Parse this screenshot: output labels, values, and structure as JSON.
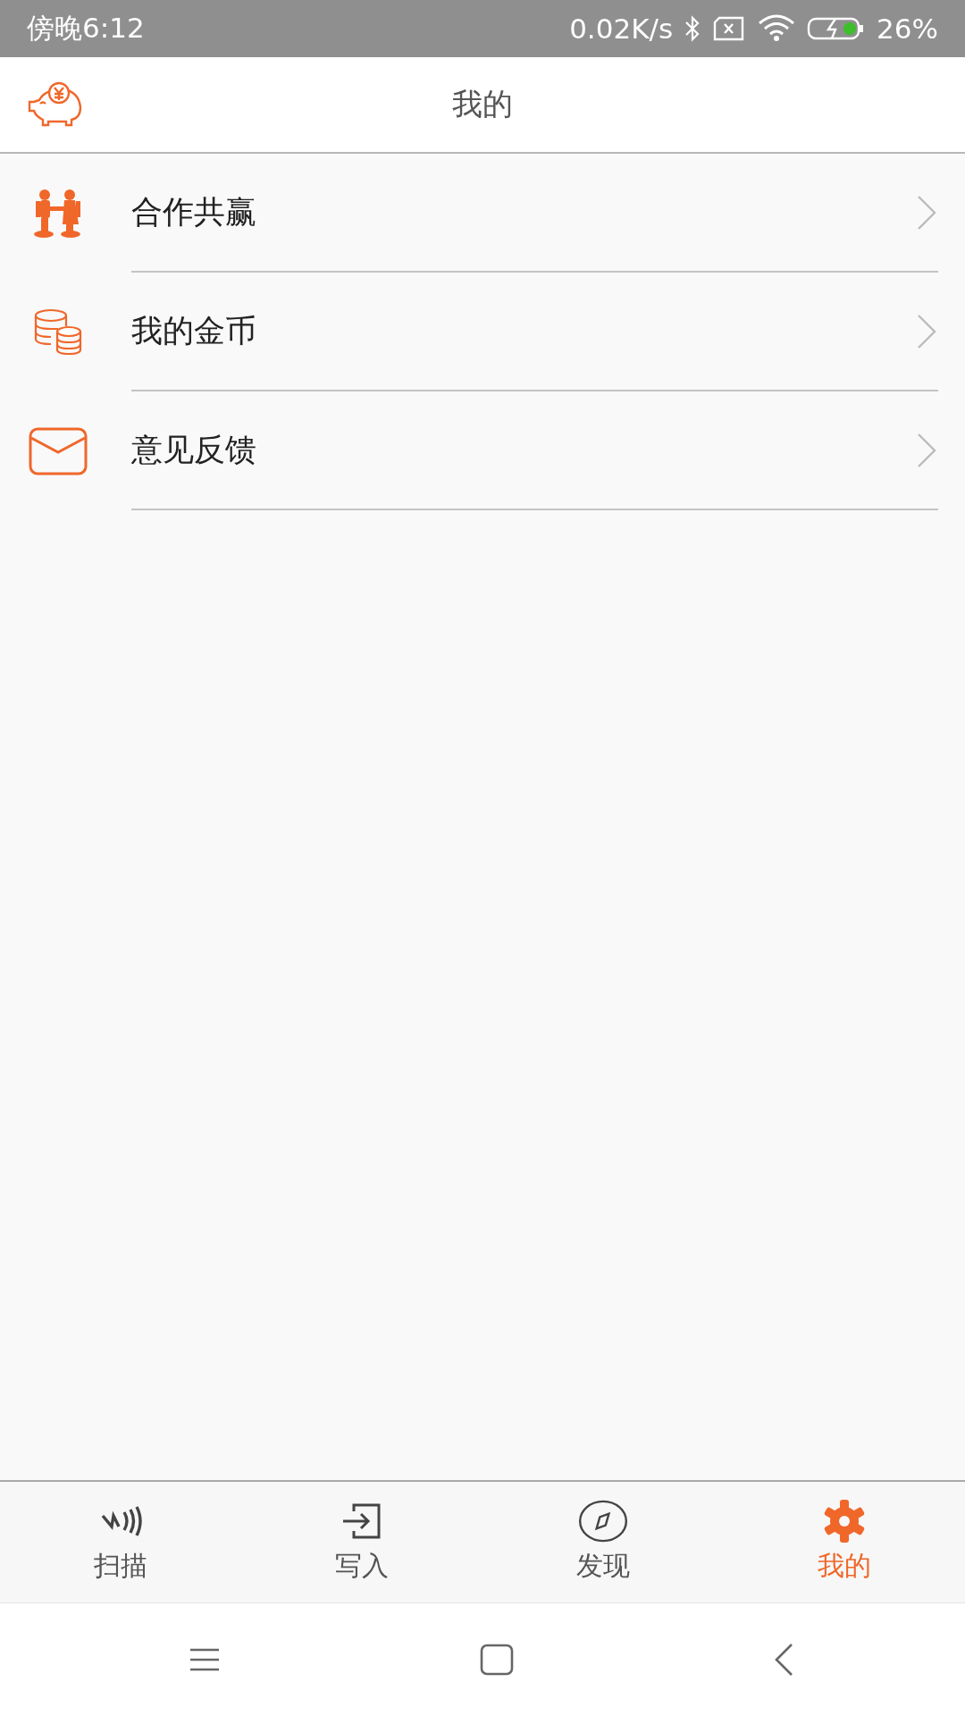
{
  "status_bar": {
    "time": "傍晚6:12",
    "net_speed": "0.02K/s",
    "battery": "26%"
  },
  "header": {
    "title": "我的"
  },
  "menu": [
    {
      "kind": "handshake",
      "label": "合作共赢"
    },
    {
      "kind": "coins",
      "label": "我的金币"
    },
    {
      "kind": "mail",
      "label": "意见反馈"
    }
  ],
  "tabs": [
    {
      "kind": "nfc",
      "label": "扫描",
      "selected": false
    },
    {
      "kind": "enter",
      "label": "写入",
      "selected": false
    },
    {
      "kind": "compass",
      "label": "发现",
      "selected": false
    },
    {
      "kind": "gear",
      "label": "我的",
      "selected": true
    }
  ]
}
